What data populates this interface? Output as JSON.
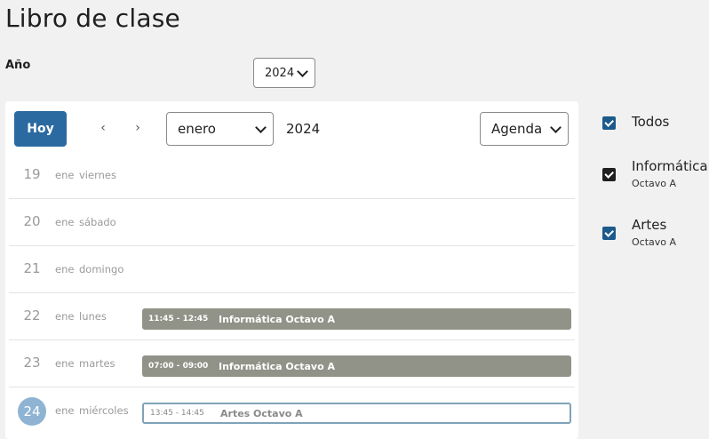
{
  "page": {
    "title": "Libro de clase"
  },
  "year_filter": {
    "label": "Año",
    "selected": "2024"
  },
  "toolbar": {
    "today_label": "Hoy",
    "prev_icon": "‹",
    "next_icon": "›",
    "month_selected": "enero",
    "year": "2024",
    "view_selected": "Agenda"
  },
  "agenda": [
    {
      "day": "19",
      "month": "ene",
      "weekday": "viernes",
      "today": false,
      "events": []
    },
    {
      "day": "20",
      "month": "ene",
      "weekday": "sábado",
      "today": false,
      "events": []
    },
    {
      "day": "21",
      "month": "ene",
      "weekday": "domingo",
      "today": false,
      "events": []
    },
    {
      "day": "22",
      "month": "ene",
      "weekday": "lunes",
      "today": false,
      "events": [
        {
          "time": "11:45 - 12:45",
          "title": "Informática Octavo A",
          "style": "filled"
        }
      ]
    },
    {
      "day": "23",
      "month": "ene",
      "weekday": "martes",
      "today": false,
      "events": [
        {
          "time": "07:00 - 09:00",
          "title": "Informática Octavo A",
          "style": "filled"
        }
      ]
    },
    {
      "day": "24",
      "month": "ene",
      "weekday": "miércoles",
      "today": true,
      "events": [
        {
          "time": "13:45 - 14:45",
          "title": "Artes Octavo A",
          "style": "outline"
        }
      ]
    }
  ],
  "filters": [
    {
      "label": "Todos",
      "sub": "",
      "checked": true,
      "color": "#1c5a8b"
    },
    {
      "label": "Informática",
      "sub": "Octavo A",
      "checked": true,
      "color": "#1f1f1f"
    },
    {
      "label": "Artes",
      "sub": "Octavo A",
      "checked": true,
      "color": "#1c5a8b"
    }
  ],
  "colors": {
    "primary": "#2b6aa0",
    "event_filled": "#929388",
    "event_outline": "#7fa3ba",
    "today_circle": "#8fb3d3"
  }
}
